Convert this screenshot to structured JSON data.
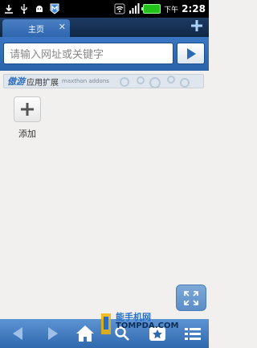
{
  "status_bar": {
    "period": "下午",
    "time": "2:28",
    "icons": [
      "download-icon",
      "usb-icon",
      "android-debug-icon",
      "maxthon-icon",
      "wifi-icon",
      "signal-icon",
      "battery-icon"
    ]
  },
  "tabs": [
    {
      "label": "主页",
      "active": true
    }
  ],
  "address_bar": {
    "placeholder": "请输入网址或关键字"
  },
  "addons": {
    "brand": "傲游",
    "title": "应用扩展",
    "subtitle": "maxthon addons"
  },
  "quick_add": {
    "label": "添加"
  },
  "watermark": {
    "line1": "能手机网",
    "line2": "TOMPDA.COM"
  },
  "colors": {
    "toolbar_blue": "#2f68ae",
    "address_blue": "#3a76c2",
    "background": "#f1f0ee"
  }
}
